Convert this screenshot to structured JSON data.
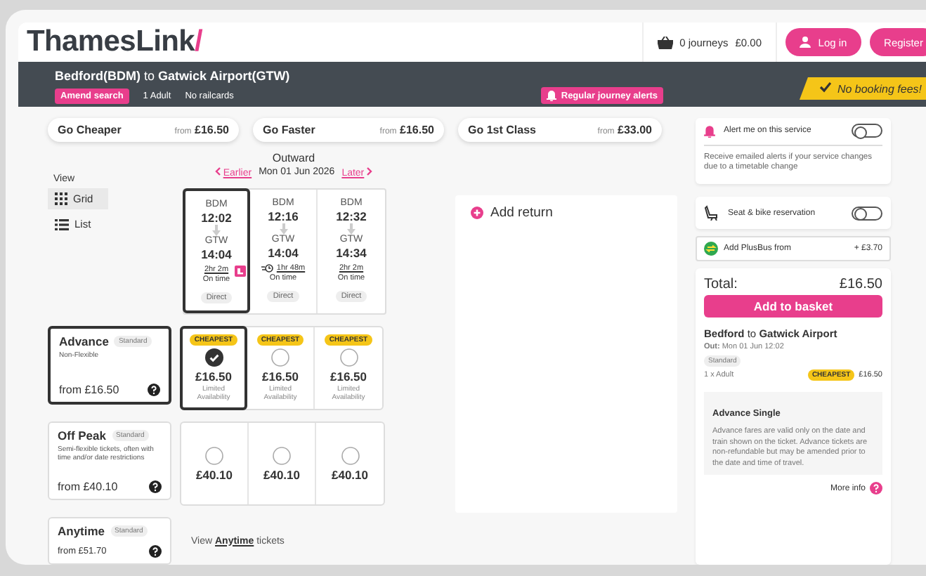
{
  "header": {
    "logo": "ThamesLink",
    "logo_mark": "/",
    "basket_count": "0 journeys",
    "basket_total": "£0.00",
    "login": "Log in",
    "register": "Register"
  },
  "route": {
    "from": "Bedford(BDM)",
    "joiner": "to",
    "to": "Gatwick Airport(GTW)",
    "amend": "Amend search",
    "passengers": "1 Adult",
    "railcards": "No railcards",
    "alerts": "Regular journey alerts",
    "no_fees": "No booking fees!"
  },
  "filters": [
    {
      "label": "Go Cheaper",
      "from": "from",
      "price": "£16.50"
    },
    {
      "label": "Go Faster",
      "from": "from",
      "price": "£16.50"
    },
    {
      "label": "Go 1st Class",
      "from": "from",
      "price": "£33.00"
    }
  ],
  "view": {
    "label": "View",
    "options": [
      {
        "label": "Grid",
        "selected": true
      },
      {
        "label": "List",
        "selected": false
      }
    ]
  },
  "outward": {
    "title": "Outward",
    "earlier": "Earlier",
    "date": "Mon 01 Jun 2026",
    "later": "Later"
  },
  "journeys": [
    {
      "dep_station": "BDM",
      "dep_time": "12:02",
      "arr_station": "GTW",
      "arr_time": "14:04",
      "duration": "2hr 2m",
      "status": "On time",
      "type": "Direct",
      "kind": "reservable",
      "selected": true
    },
    {
      "dep_station": "BDM",
      "dep_time": "12:16",
      "arr_station": "GTW",
      "arr_time": "14:04",
      "duration": "1hr 48m",
      "status": "On time",
      "type": "Direct",
      "kind": "fastest",
      "selected": false
    },
    {
      "dep_station": "BDM",
      "dep_time": "12:32",
      "arr_station": "GTW",
      "arr_time": "14:34",
      "duration": "2hr 2m",
      "status": "On time",
      "type": "Direct",
      "kind": "plain",
      "selected": false
    }
  ],
  "fares": [
    {
      "name": "Advance",
      "class": "Standard",
      "description": "Non-Flexible",
      "from": "from £16.50",
      "selected": true,
      "kind": "grid",
      "cells": [
        {
          "badge": "CHEAPEST",
          "price": "£16.50",
          "note": "Limited Availability",
          "selected": true
        },
        {
          "badge": "CHEAPEST",
          "price": "£16.50",
          "note": "Limited Availability",
          "selected": false
        },
        {
          "badge": "CHEAPEST",
          "price": "£16.50",
          "note": "Limited Availability",
          "selected": false
        }
      ]
    },
    {
      "name": "Off Peak",
      "class": "Standard",
      "description": "Semi-flexible tickets, often with time and/or date restrictions",
      "from": "from £40.10",
      "selected": false,
      "kind": "grid",
      "cells": [
        {
          "price": "£40.10",
          "selected": false
        },
        {
          "price": "£40.10",
          "selected": false
        },
        {
          "price": "£40.10",
          "selected": false
        }
      ]
    },
    {
      "name": "Anytime",
      "class": "Standard",
      "from": "from £51.70",
      "selected": false,
      "kind": "link",
      "link_prefix": "View",
      "link": "Anytime",
      "link_suffix": "tickets"
    }
  ],
  "add_return": "Add return",
  "sidebar": {
    "alert": {
      "label": "Alert me on this service",
      "on": false,
      "note": "Receive emailed alerts if your service changes due to a timetable change"
    },
    "seat": {
      "label": "Seat & bike reservation",
      "on": false
    },
    "plusbus": {
      "label": "Add PlusBus from",
      "price": "+ £3.70"
    },
    "total_label": "Total:",
    "total": "£16.50",
    "add_button": "Add to basket",
    "summary": {
      "from": "Bedford",
      "joiner": "to",
      "to": "Gatwick Airport",
      "out_label": "Out:",
      "out": "Mon 01 Jun 12:02",
      "class": "Standard",
      "passenger": "1 x Adult",
      "badge": "CHEAPEST",
      "price": "£16.50"
    },
    "info": {
      "title": "Advance Single",
      "text": "Advance fares are valid only on the date and train shown on the ticket. Advance tickets are non-refundable but may be amended prior to the date and time of travel."
    },
    "more_info": "More info"
  }
}
